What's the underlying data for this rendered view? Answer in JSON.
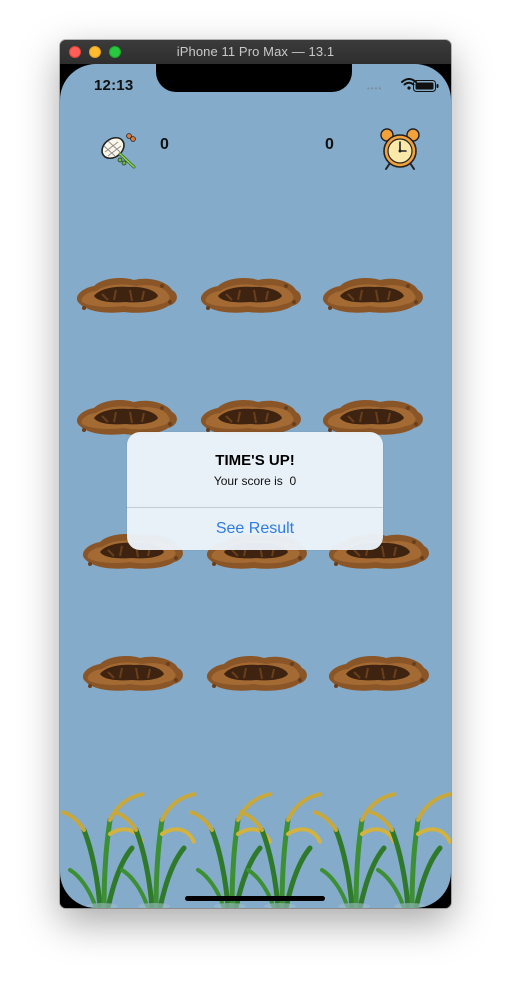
{
  "window": {
    "title": "iPhone 11 Pro Max — 13.1"
  },
  "status_bar": {
    "time": "12:13",
    "signal": "••••"
  },
  "game": {
    "left_counter": "0",
    "right_counter": "0",
    "icons": {
      "left": "butterfly-net-icon",
      "right": "alarm-clock-icon"
    }
  },
  "alert": {
    "title": "TIME'S UP!",
    "message": "Your score is  0",
    "action_label": "See Result"
  },
  "colors": {
    "background": "#84abc9",
    "accent": "#2e7be3",
    "dirt": "#7a4a22"
  }
}
